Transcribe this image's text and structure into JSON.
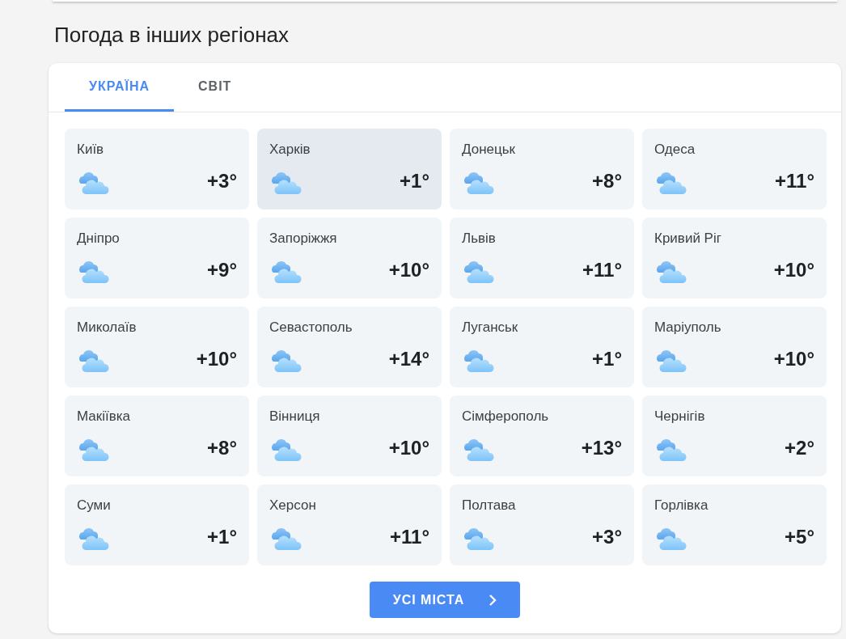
{
  "heading": "Погода в інших регіонах",
  "tabs": [
    {
      "label": "УКРАЇНА",
      "selected": true
    },
    {
      "label": "СВІТ",
      "selected": false
    }
  ],
  "cities": [
    {
      "name": "Київ",
      "temp": "+3°",
      "hovered": false
    },
    {
      "name": "Харків",
      "temp": "+1°",
      "hovered": true
    },
    {
      "name": "Донецьк",
      "temp": "+8°",
      "hovered": false
    },
    {
      "name": "Одеса",
      "temp": "+11°",
      "hovered": false
    },
    {
      "name": "Дніпро",
      "temp": "+9°",
      "hovered": false
    },
    {
      "name": "Запоріжжя",
      "temp": "+10°",
      "hovered": false
    },
    {
      "name": "Львів",
      "temp": "+11°",
      "hovered": false
    },
    {
      "name": "Кривий Ріг",
      "temp": "+10°",
      "hovered": false
    },
    {
      "name": "Миколаїв",
      "temp": "+10°",
      "hovered": false
    },
    {
      "name": "Севастополь",
      "temp": "+14°",
      "hovered": false
    },
    {
      "name": "Луганськ",
      "temp": "+1°",
      "hovered": false
    },
    {
      "name": "Маріуполь",
      "temp": "+10°",
      "hovered": false
    },
    {
      "name": "Макіївка",
      "temp": "+8°",
      "hovered": false
    },
    {
      "name": "Вінниця",
      "temp": "+10°",
      "hovered": false
    },
    {
      "name": "Сімферополь",
      "temp": "+13°",
      "hovered": false
    },
    {
      "name": "Чернігів",
      "temp": "+2°",
      "hovered": false
    },
    {
      "name": "Суми",
      "temp": "+1°",
      "hovered": false
    },
    {
      "name": "Херсон",
      "temp": "+11°",
      "hovered": false
    },
    {
      "name": "Полтава",
      "temp": "+3°",
      "hovered": false
    },
    {
      "name": "Горлівка",
      "temp": "+5°",
      "hovered": false
    }
  ],
  "all_button": {
    "label": "УСІ МІСТА"
  }
}
